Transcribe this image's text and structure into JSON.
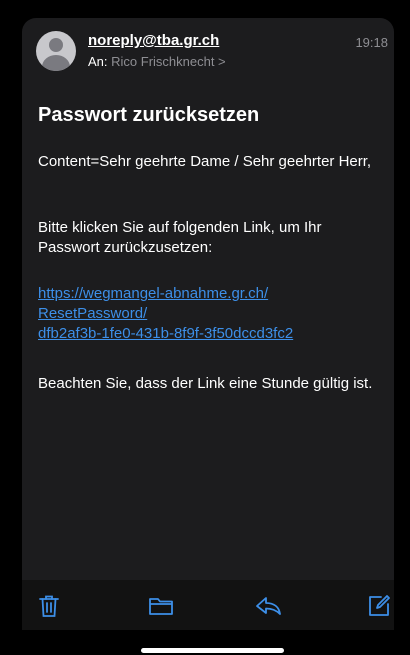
{
  "header": {
    "sender": "noreply@tba.gr.ch",
    "recipient_prefix": "An:",
    "recipient": "Rico Frischknecht >",
    "time": "19:18"
  },
  "email": {
    "subject": "Passwort zurücksetzen",
    "greeting": "Content=Sehr geehrte Dame / Sehr geehrter Herr,",
    "instruction": "Bitte klicken Sie auf folgenden Link, um Ihr Passwort zurückzusetzen:",
    "link_line1": "https://wegmangel-abnahme.gr.ch/",
    "link_line2": "ResetPassword/",
    "link_line3": "dfb2af3b-1fe0-431b-8f9f-3f50dccd3fc2",
    "note": "Beachten Sie, dass der Link eine Stunde gültig ist."
  },
  "toolbar": {
    "icons": [
      "trash-icon",
      "folder-icon",
      "reply-icon",
      "compose-icon"
    ],
    "accent": "#3d8fe8"
  }
}
